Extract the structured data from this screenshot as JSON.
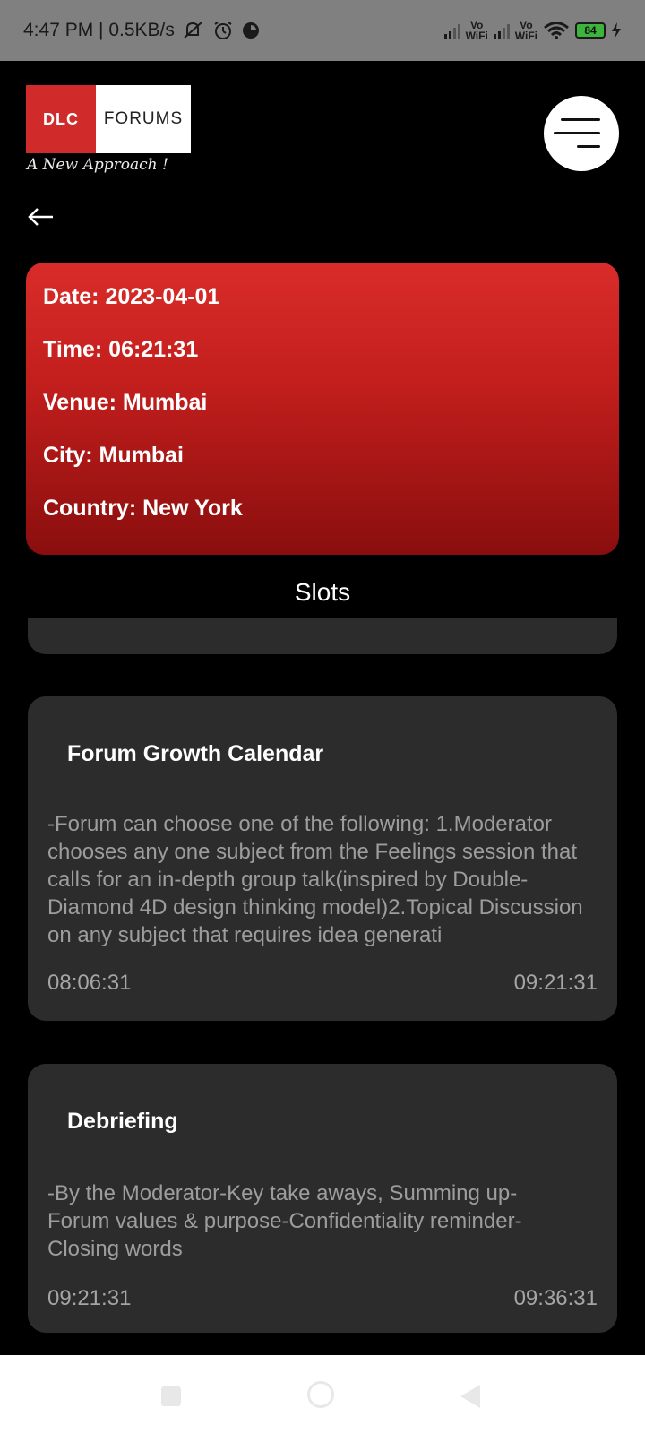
{
  "status_bar": {
    "time_speed": "4:47 PM | 0.5KB/s",
    "vowifi_1": "Vo\nWiFi",
    "vowifi_2": "Vo\nWiFi",
    "battery": "84"
  },
  "header": {
    "logo_left": "DLC",
    "logo_right": "FORUMS",
    "tagline": "A New Approach !"
  },
  "info": {
    "date": "Date: 2023-04-01",
    "time": "Time: 06:21:31",
    "venue": "Venue: Mumbai",
    "city": "City: Mumbai",
    "country": "Country: New York"
  },
  "slots_title": "Slots",
  "slots": [
    {
      "title": "Forum Growth Calendar",
      "description": "-Forum can choose one of the following: 1.Moderator chooses any one subject from the Feelings session that calls for an in-depth group talk(inspired by Double-Diamond 4D design thinking model)2.Topical Discussion on any subject that requires idea generati",
      "start": "08:06:31",
      "end": "09:21:31"
    },
    {
      "title": "Debriefing",
      "description": "-By the Moderator-Key take aways, Summing up-Forum values & purpose-Confidentiality reminder-Closing words",
      "start": "09:21:31",
      "end": "09:36:31"
    }
  ],
  "colors": {
    "accent_red": "#d12a2a",
    "card_bg": "#2c2c2c"
  }
}
